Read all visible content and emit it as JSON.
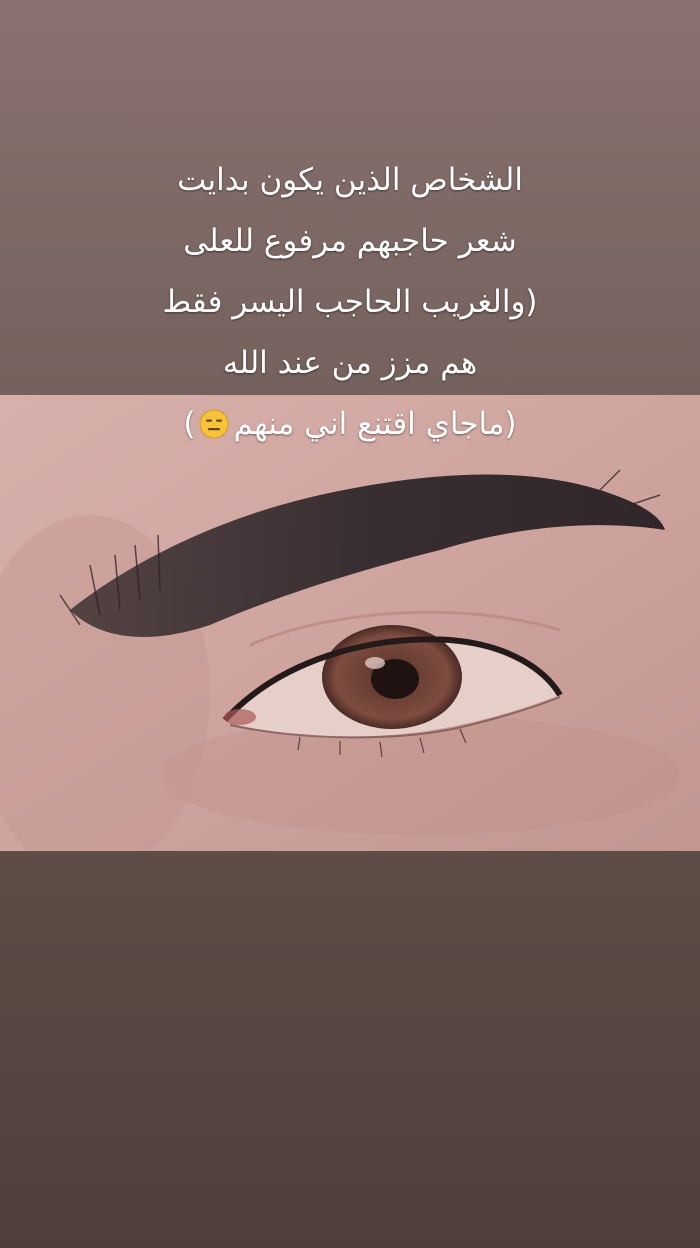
{
  "story": {
    "background_top": "#8a7270",
    "background_bottom": "#4f3f3b"
  },
  "photo": {
    "icon": "eye-closeup-photo"
  },
  "caption": {
    "lines": [
      "الشخاص الذين يكون بدايت",
      "شعر حاجبهم مرفوع للعلى",
      "(والغريب الحاجب اليسر فقط",
      "هم مزز من عند الله",
      "(ماجاي اقتنع اني منهم"
    ],
    "closing_paren": ")",
    "emoji_icon": "expressionless-face-emoji"
  }
}
